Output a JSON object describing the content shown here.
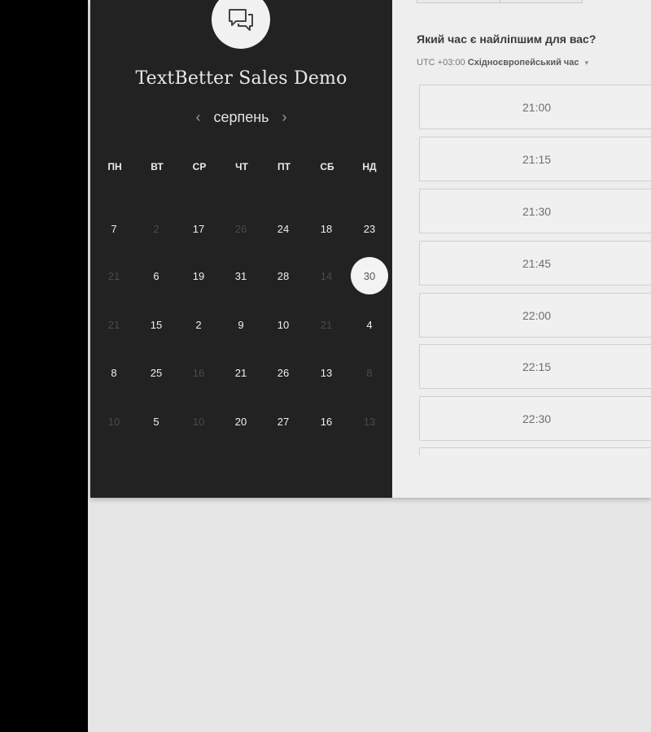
{
  "event": {
    "title": "TextBetter Sales Demo",
    "avatar_icon": "chat-bubbles-icon"
  },
  "calendar": {
    "month": "серпень",
    "prev_icon": "‹",
    "next_icon": "›",
    "weekdays": [
      "ПН",
      "ВТ",
      "СР",
      "ЧТ",
      "ПТ",
      "СБ",
      "НД"
    ],
    "weeks": [
      [
        {
          "d": "7",
          "a": true
        },
        {
          "d": "2",
          "a": false
        },
        {
          "d": "17",
          "a": true
        },
        {
          "d": "26",
          "a": false
        },
        {
          "d": "24",
          "a": true
        },
        {
          "d": "18",
          "a": true
        },
        {
          "d": "23",
          "a": true
        }
      ],
      [
        {
          "d": "21",
          "a": false
        },
        {
          "d": "6",
          "a": true
        },
        {
          "d": "19",
          "a": true
        },
        {
          "d": "31",
          "a": true
        },
        {
          "d": "28",
          "a": true
        },
        {
          "d": "14",
          "a": false
        },
        {
          "d": "30",
          "a": true,
          "selected": true
        }
      ],
      [
        {
          "d": "21",
          "a": false
        },
        {
          "d": "15",
          "a": true
        },
        {
          "d": "2",
          "a": true
        },
        {
          "d": "9",
          "a": true
        },
        {
          "d": "10",
          "a": true
        },
        {
          "d": "21",
          "a": false
        },
        {
          "d": "4",
          "a": true
        }
      ],
      [
        {
          "d": "8",
          "a": true
        },
        {
          "d": "25",
          "a": true
        },
        {
          "d": "16",
          "a": false
        },
        {
          "d": "21",
          "a": true
        },
        {
          "d": "26",
          "a": true
        },
        {
          "d": "13",
          "a": true
        },
        {
          "d": "8",
          "a": false
        }
      ],
      [
        {
          "d": "10",
          "a": false
        },
        {
          "d": "5",
          "a": true
        },
        {
          "d": "10",
          "a": false
        },
        {
          "d": "20",
          "a": true
        },
        {
          "d": "27",
          "a": true
        },
        {
          "d": "16",
          "a": true
        },
        {
          "d": "13",
          "a": false
        }
      ]
    ]
  },
  "times": {
    "question": "Який час є найліпшим для вас?",
    "timezone_offset": "UTC +03:00",
    "timezone_name": "Східноєвропейський час",
    "slots": [
      "21:00",
      "21:15",
      "21:30",
      "21:45",
      "22:00",
      "22:15",
      "22:30"
    ]
  }
}
